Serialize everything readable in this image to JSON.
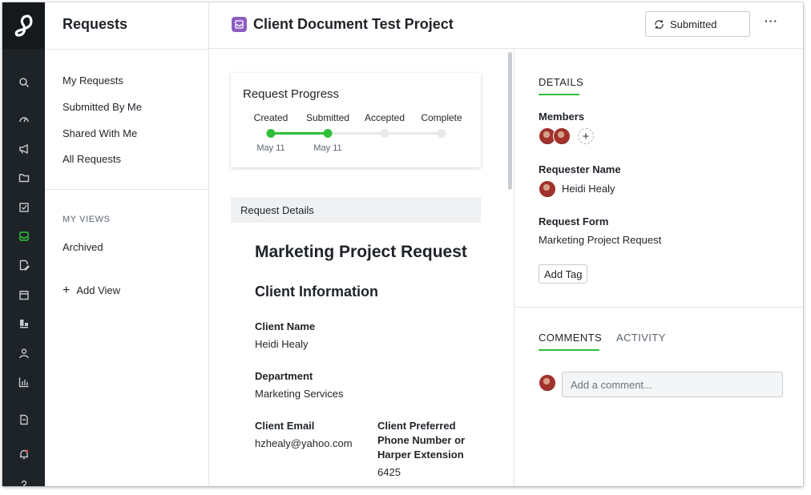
{
  "sidebar": {
    "icons": [
      "search-icon",
      "speedometer-icon",
      "megaphone-icon",
      "folder-icon",
      "checkbox-icon",
      "inbox-icon",
      "edit-document-icon",
      "calendar-icon",
      "dashboard-icon",
      "person-icon",
      "bar-chart-icon",
      "document-icon",
      "bell-icon",
      "help-icon"
    ],
    "active_icon": "inbox-icon",
    "accent_color": "#2fbf3a"
  },
  "left_panel": {
    "title": "Requests",
    "items": [
      "My Requests",
      "Submitted By Me",
      "Shared With Me",
      "All Requests"
    ],
    "views_heading": "MY VIEWS",
    "views": [
      "Archived"
    ],
    "add_view_label": "Add View"
  },
  "header": {
    "project_title": "Client Document Test Project",
    "project_icon_color": "#8d5cc0",
    "status_label": "Submitted",
    "more_label": "···"
  },
  "progress": {
    "title": "Request Progress",
    "steps": [
      {
        "label": "Created",
        "date": "May 11",
        "done": true
      },
      {
        "label": "Submitted",
        "date": "May 11",
        "done": true
      },
      {
        "label": "Accepted",
        "date": "",
        "done": false
      },
      {
        "label": "Complete",
        "date": "",
        "done": false
      }
    ]
  },
  "request_details": {
    "bar_label": "Request Details",
    "form_title": "Marketing Project Request",
    "section_title": "Client Information",
    "fields": {
      "client_name": {
        "label": "Client Name",
        "value": "Heidi Healy"
      },
      "department": {
        "label": "Department",
        "value": "Marketing Services"
      },
      "client_email": {
        "label": "Client Email",
        "value": "hzhealy@yahoo.com"
      },
      "phone": {
        "label": "Client Preferred Phone Number or Harper Extension",
        "value": "6425"
      }
    }
  },
  "right_panel": {
    "details_tab": "DETAILS",
    "members_label": "Members",
    "add_member_label": "+",
    "requester_label": "Requester Name",
    "requester_value": "Heidi Healy",
    "form_label": "Request Form",
    "form_value": "Marketing Project Request",
    "add_tag_label": "Add Tag",
    "comments_tab": "COMMENTS",
    "activity_tab": "ACTIVITY",
    "comment_placeholder": "Add a comment..."
  }
}
